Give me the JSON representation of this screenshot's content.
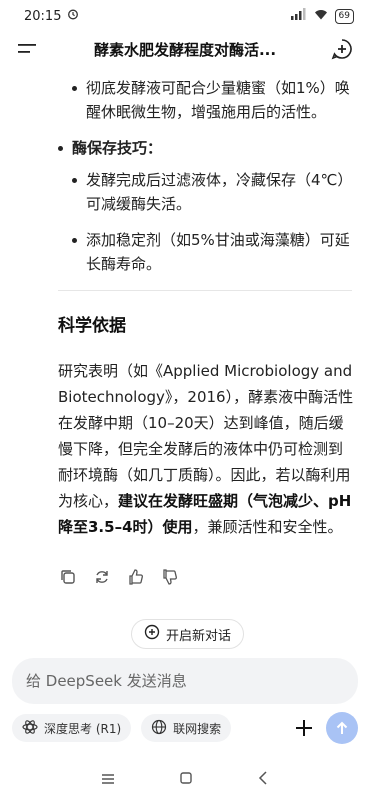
{
  "status": {
    "time": "20:15",
    "battery": "69"
  },
  "header": {
    "title": "酵素水肥发酵程度对酶活..."
  },
  "content": {
    "bullets_top": [
      {
        "level": 2,
        "text": "彻底发酵液可配合少量糖蜜（如1%）唤醒休眠微生物，增强施用后的活性。"
      }
    ],
    "section_tip": {
      "label": "酶保存技巧："
    },
    "tip_items": [
      "发酵完成后过滤液体，冷藏保存（4℃）可减缓酶失活。",
      "添加稳定剂（如5%甘油或海藻糖）可延长酶寿命。"
    ],
    "science_title": "科学依据",
    "para_part1": "研究表明（如《Applied Microbiology and Biotechnology》，2016），酵素液中酶活性在发酵中期（10–20天）达到峰值，随后缓慢下降，但完全发酵后的液体中仍可检测到耐环境酶（如几丁质酶）。因此，若以酶利用为核心，",
    "para_bold": "建议在发酵旺盛期（气泡减少、pH降至3.5–4时）使用",
    "para_part2": "，兼顾活性和安全性。"
  },
  "new_chat": {
    "label": "开启新对话"
  },
  "composer": {
    "placeholder": "给 DeepSeek 发送消息"
  },
  "toolbar": {
    "deep_think": "深度思考 (R1)",
    "web_search": "联网搜索"
  }
}
